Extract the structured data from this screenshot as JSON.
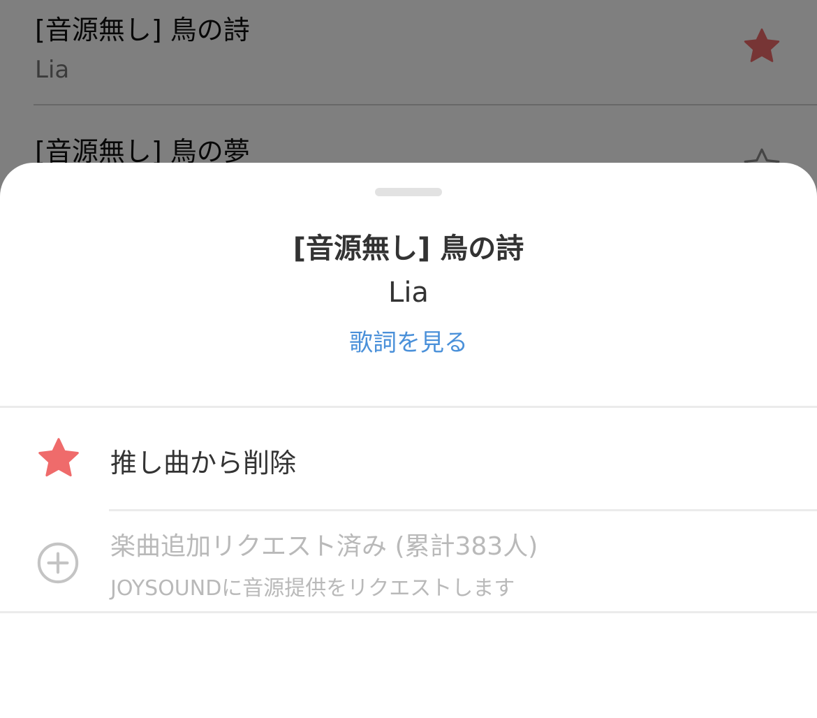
{
  "background_list": {
    "items": [
      {
        "title": "[音源無し] 鳥の詩",
        "artist": "Lia",
        "favorited": true
      },
      {
        "title": "[音源無し] 鳥の夢",
        "artist": "",
        "favorited": false
      }
    ]
  },
  "sheet": {
    "title": "[音源無し] 鳥の詩",
    "artist": "Lia",
    "lyrics_link": "歌詞を見る"
  },
  "actions": {
    "favorite": {
      "label": "推し曲から削除",
      "icon": "star-icon"
    },
    "request": {
      "label": "楽曲追加リクエスト済み (累計383人)",
      "sublabel": "JOYSOUNDに音源提供をリクエストします",
      "icon": "plus-circle-icon"
    }
  },
  "colors": {
    "accent_link": "#4a90d9",
    "favorite_star": "#ef6b6b",
    "disabled_text": "#b9b9b9",
    "title_text": "#333333"
  }
}
